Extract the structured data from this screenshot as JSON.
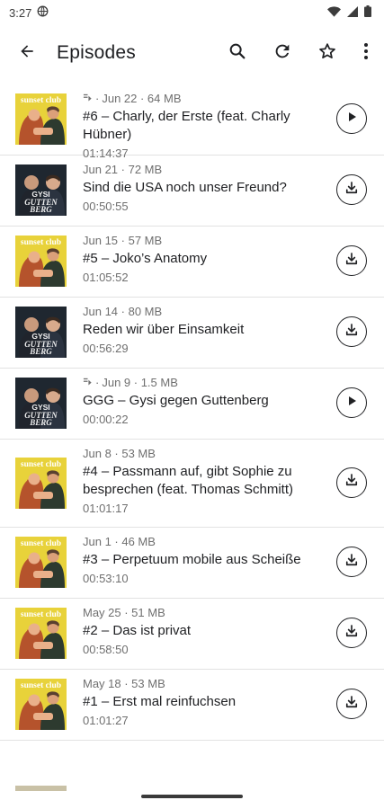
{
  "status": {
    "time": "3:27"
  },
  "appbar": {
    "title": "Episodes"
  },
  "episodes": [
    {
      "meta": "Jun 22 · 64 MB",
      "title": "#6 – Charly, der Erste (feat. Charly Hübner)",
      "duration": "01:14:37",
      "action": "play",
      "cover": "sunset-club",
      "downloaded": true
    },
    {
      "meta": "Jun 21 · 72 MB",
      "title": "Sind die USA noch unser Freund?",
      "duration": "00:50:55",
      "action": "download",
      "cover": "gysi-guttenberg",
      "downloaded": false
    },
    {
      "meta": "Jun 15 · 57 MB",
      "title": "#5 – Joko’s Anatomy",
      "duration": "01:05:52",
      "action": "download",
      "cover": "sunset-club",
      "downloaded": false
    },
    {
      "meta": "Jun 14 · 80 MB",
      "title": "Reden wir über Einsamkeit",
      "duration": "00:56:29",
      "action": "download",
      "cover": "gysi-guttenberg",
      "downloaded": false
    },
    {
      "meta": "Jun 9 · 1.5 MB",
      "title": "GGG – Gysi gegen Guttenberg",
      "duration": "00:00:22",
      "action": "play",
      "cover": "gysi-guttenberg",
      "downloaded": true
    },
    {
      "meta": "Jun 8 · 53 MB",
      "title": "#4 – Passmann auf, gibt Sophie zu besprechen (feat. Thomas Schmitt)",
      "duration": "01:01:17",
      "action": "download",
      "cover": "sunset-club",
      "downloaded": false
    },
    {
      "meta": "Jun 1 · 46 MB",
      "title": "#3 – Perpetuum mobile aus Scheiße",
      "duration": "00:53:10",
      "action": "download",
      "cover": "sunset-club",
      "downloaded": false
    },
    {
      "meta": "May 25 · 51 MB",
      "title": "#2 – Das ist privat",
      "duration": "00:58:50",
      "action": "download",
      "cover": "sunset-club",
      "downloaded": false
    },
    {
      "meta": "May 18 · 53 MB",
      "title": "#1 – Erst mal reinfuchsen",
      "duration": "01:01:27",
      "action": "download",
      "cover": "sunset-club",
      "downloaded": false
    }
  ],
  "covers": {
    "sunset-club": {
      "text": "sunset club"
    },
    "gysi-guttenberg": {
      "text": "GYSI GUTTEN BERG"
    }
  },
  "colors": {
    "sunset_yellow": "#e8d23a",
    "sunset_text": "#ffffff",
    "gg_dark": "#1f2730",
    "gg_text": "#f0f0f0"
  }
}
